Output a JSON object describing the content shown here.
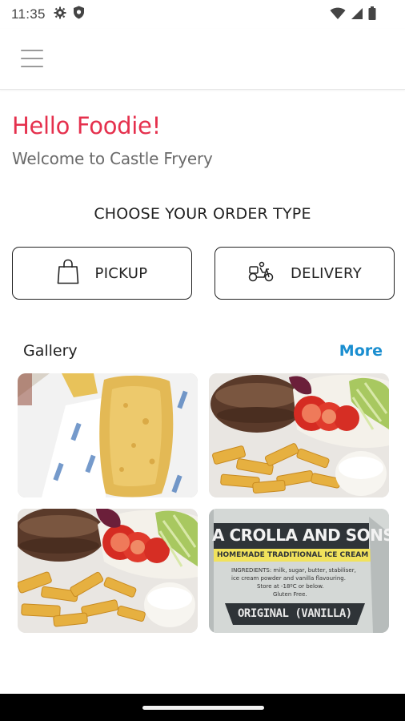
{
  "status_bar": {
    "time": "11:35",
    "icons": [
      "gear-icon",
      "shield-icon",
      "wifi-icon",
      "signal-icon",
      "battery-icon"
    ]
  },
  "header": {
    "menu_icon": "hamburger-menu-icon"
  },
  "greeting": {
    "title": "Hello Foodie!",
    "subtitle": "Welcome to Castle Fryery"
  },
  "order_type": {
    "heading": "CHOOSE YOUR ORDER TYPE",
    "pickup_label": "PICKUP",
    "pickup_icon": "shopping-bag-icon",
    "delivery_label": "DELIVERY",
    "delivery_icon": "scooter-icon"
  },
  "gallery": {
    "title": "Gallery",
    "more_label": "More",
    "images": [
      {
        "name": "battered-fish-chips-photo"
      },
      {
        "name": "burger-chips-salad-photo"
      },
      {
        "name": "burger-chips-salad-photo-2"
      },
      {
        "name": "ice-cream-tub-photo",
        "text_lines": [
          "A CROLLA AND SONS",
          "HOMEMADE TRADITIONAL ICE CREAM",
          "INGREDIENTS: milk, sugar, butter, stabiliser,",
          "ice cream powder and vanilla flavouring.",
          "Store at -18ºC or below.",
          "Gluten Free.",
          "ORIGINAL (VANILLA)"
        ]
      }
    ]
  },
  "colors": {
    "greeting": "#e5304d",
    "link": "#1a8ed0",
    "text": "#222222",
    "muted": "#6a6a6a"
  }
}
